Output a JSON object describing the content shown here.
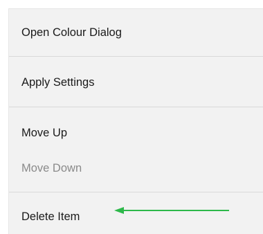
{
  "menu": {
    "items": [
      {
        "label": "Open Colour Dialog",
        "enabled": true
      },
      {
        "label": "Apply Settings",
        "enabled": true
      },
      {
        "label": "Move Up",
        "enabled": true
      },
      {
        "label": "Move Down",
        "enabled": false
      },
      {
        "label": "Delete Item",
        "enabled": true
      }
    ]
  },
  "annotation": {
    "arrow_color": "#2db84a",
    "points_to": "Delete Item"
  },
  "colors": {
    "menu_background": "#f2f2f2",
    "separator": "#d9d9d9",
    "text": "#1a1a1a",
    "disabled_text": "#8a8a8a"
  }
}
